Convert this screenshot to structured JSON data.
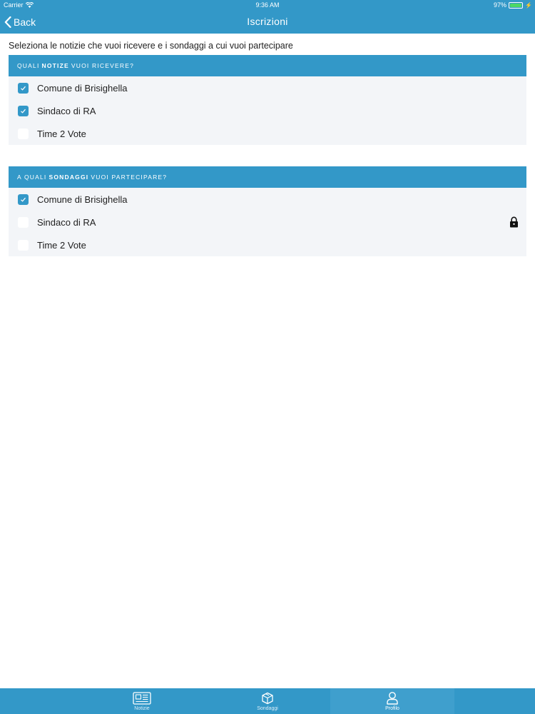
{
  "status_bar": {
    "carrier": "Carrier",
    "time": "9:36 AM",
    "battery": "97%"
  },
  "nav": {
    "back_label": "Back",
    "title": "Iscrizioni"
  },
  "intro": "Seleziona le notizie che vuoi ricevere e i sondaggi a cui vuoi partecipare",
  "section_news": {
    "header_pre": "Quali",
    "header_bold": "Notize",
    "header_post": "vuoi ricevere?",
    "items": [
      {
        "label": "Comune di Brisighella",
        "checked": true
      },
      {
        "label": "Sindaco di RA",
        "checked": true
      },
      {
        "label": "Time 2 Vote",
        "checked": false
      }
    ]
  },
  "section_polls": {
    "header_pre": "A quali",
    "header_bold": "Sondaggi",
    "header_post": "vuoi partecipare?",
    "items": [
      {
        "label": "Comune di Brisighella",
        "checked": true
      },
      {
        "label": "Sindaco di RA",
        "checked": false,
        "locked": true
      },
      {
        "label": "Time 2 Vote",
        "checked": false
      }
    ]
  },
  "tabs": [
    {
      "label": "Notizie",
      "icon": "newspaper-icon",
      "active": false
    },
    {
      "label": "Sondaggi",
      "icon": "ballot-box-icon",
      "active": false
    },
    {
      "label": "Profilo",
      "icon": "user-icon",
      "active": true
    }
  ],
  "colors": {
    "primary": "#3398c8",
    "row_bg": "#f3f5f8",
    "battery": "#4cd964"
  }
}
